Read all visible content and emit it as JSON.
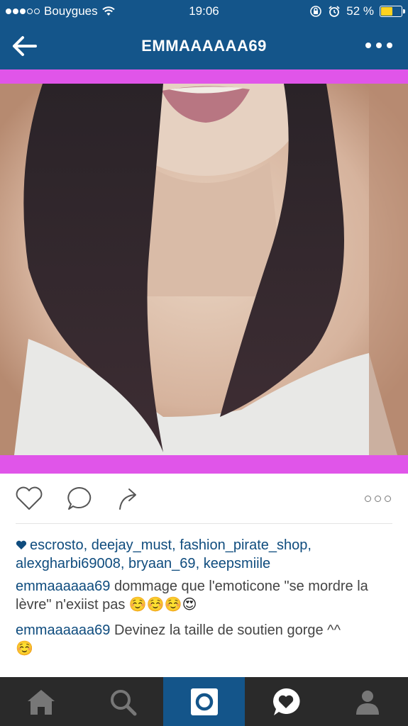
{
  "status": {
    "carrier": "Bouygues",
    "time": "19:06",
    "battery_text": "52 %",
    "battery_level": 0.52,
    "signal_icon": "signal-dots-icon",
    "wifi_icon": "wifi-icon",
    "lock_icon": "rotation-lock-icon",
    "alarm_icon": "alarm-icon"
  },
  "header": {
    "title": "EMMAAAAAA69",
    "back_icon": "back-arrow-icon",
    "more_icon": "more-icon"
  },
  "post": {
    "image_description_icon": "post-photo",
    "likes": {
      "icon": "heart-icon",
      "users": [
        "escrosto",
        "deejay_must",
        "fashion_pirate_shop",
        "alexgharbi69008",
        "bryaan_69",
        "keepsmiile"
      ]
    },
    "comments": [
      {
        "user": "emmaaaaaa69",
        "text": "dommage que l'emoticone \"se mordre la lèvre\" n'exiist pas",
        "emoji": [
          "☺️",
          "☺️",
          "☺️",
          "😍"
        ]
      },
      {
        "user": "emmaaaaaa69",
        "text": "Devinez la taille de soutien gorge ^^",
        "emoji": [
          "☺️"
        ]
      }
    ]
  },
  "actions": {
    "like_icon": "heart-outline-icon",
    "comment_icon": "comment-icon",
    "share_icon": "share-icon",
    "options_icon": "options-icon"
  },
  "tabbar": {
    "tabs": [
      {
        "icon": "home-icon"
      },
      {
        "icon": "search-icon"
      },
      {
        "icon": "camera-icon",
        "active": true
      },
      {
        "icon": "activity-heart-icon"
      },
      {
        "icon": "profile-icon"
      }
    ]
  },
  "colors": {
    "bar_blue": "#14558a",
    "magenta": "#e055e9",
    "link_blue": "#0f4c7e",
    "tab_dark": "#2a2a2a"
  }
}
